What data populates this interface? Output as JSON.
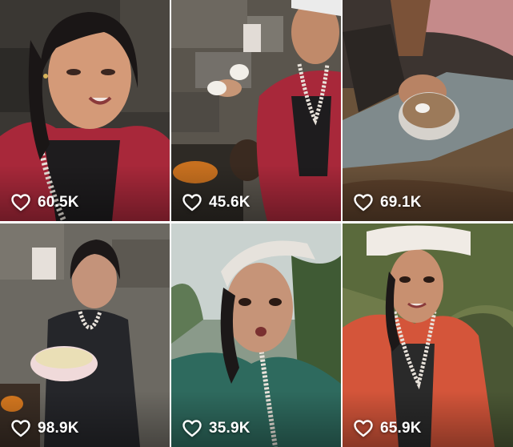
{
  "posts": [
    {
      "likes": "60.5K",
      "like_icon": "heart-outline-icon"
    },
    {
      "likes": "45.6K",
      "like_icon": "heart-outline-icon"
    },
    {
      "likes": "69.1K",
      "like_icon": "heart-outline-icon"
    },
    {
      "likes": "98.9K",
      "like_icon": "heart-outline-icon"
    },
    {
      "likes": "35.9K",
      "like_icon": "heart-outline-icon"
    },
    {
      "likes": "65.9K",
      "like_icon": "heart-outline-icon"
    }
  ],
  "colors": {
    "overlay_text": "#ffffff",
    "background": "#ffffff"
  }
}
